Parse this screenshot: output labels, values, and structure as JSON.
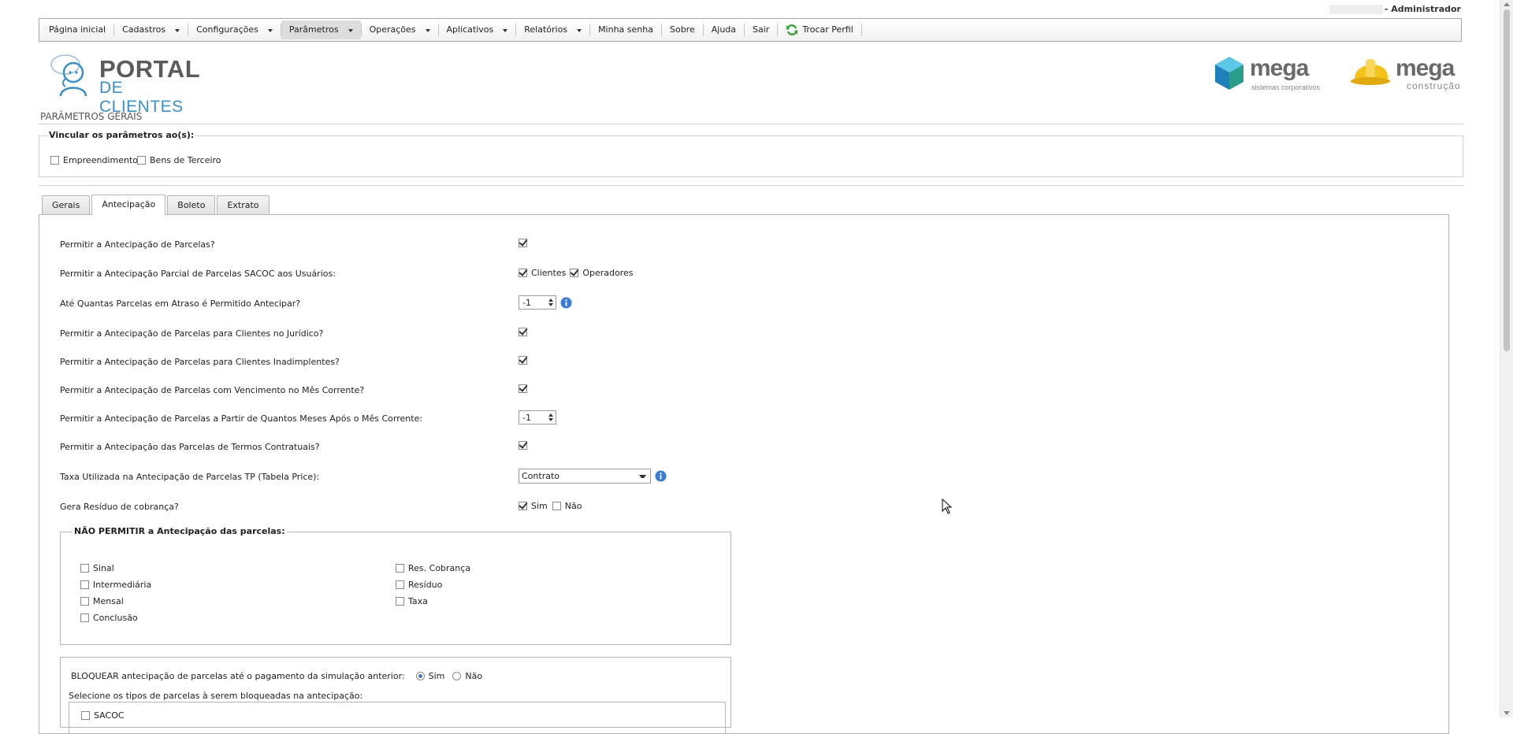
{
  "header": {
    "user_suffix": "- Administrador"
  },
  "menu": [
    {
      "label": "Página inicial",
      "has_dropdown": false
    },
    {
      "label": "Cadastros",
      "has_dropdown": true
    },
    {
      "label": "Configurações",
      "has_dropdown": true
    },
    {
      "label": "Parâmetros",
      "has_dropdown": true,
      "active": true
    },
    {
      "label": "Operações",
      "has_dropdown": true
    },
    {
      "label": "Aplicativos",
      "has_dropdown": true
    },
    {
      "label": "Relatórios",
      "has_dropdown": true
    },
    {
      "label": "Minha senha",
      "has_dropdown": false
    },
    {
      "label": "Sobre",
      "has_dropdown": false
    },
    {
      "label": "Ajuda",
      "has_dropdown": false
    },
    {
      "label": "Sair",
      "has_dropdown": false
    },
    {
      "label": "Trocar Perfil",
      "has_dropdown": false,
      "icon": "refresh-icon"
    }
  ],
  "logos": {
    "portal_title": "PORTAL",
    "portal_sub": "DE CLIENTES",
    "mega1_word": "mega",
    "mega1_tag": "sistemas corporativos",
    "mega2_word": "mega",
    "mega2_tag": "construção"
  },
  "page": {
    "title": "PARÂMETROS GERAIS",
    "vincular_legend": "Vincular os parâmetros ao(s):",
    "vincular_options": [
      {
        "label": "Empreendimento",
        "checked": false
      },
      {
        "label": "Bens de Terceiro",
        "checked": false
      }
    ]
  },
  "tabs": [
    {
      "label": "Gerais",
      "active": false
    },
    {
      "label": "Antecipação",
      "active": true
    },
    {
      "label": "Boleto",
      "active": false
    },
    {
      "label": "Extrato",
      "active": false
    }
  ],
  "form": {
    "q1": "Permitir a Antecipação de Parcelas?",
    "q2": "Permitir a Antecipação Parcial de Parcelas SACOC aos Usuários:",
    "q2_opt1": "Clientes",
    "q2_opt2": "Operadores",
    "q3": "Até Quantas Parcelas em Atraso é Permitido Antecipar?",
    "q3_value": "-1",
    "q4": "Permitir a Antecipação de Parcelas para Clientes no Jurídico?",
    "q5": "Permitir a Antecipação de Parcelas para Clientes Inadimplentes?",
    "q6": "Permitir a Antecipação de Parcelas com Vencimento no Mês Corrente?",
    "q7": "Permitir a Antecipação de Parcelas a Partir de Quantos Meses Após o Mês Corrente:",
    "q7_value": "-1",
    "q8": "Permitir a Antecipação das Parcelas de Termos Contratuais?",
    "q9": "Taxa Utilizada na Antecipação de Parcelas TP (Tabela Price):",
    "q9_value": "Contrato",
    "q10": "Gera Resíduo de cobrança?",
    "q10_yes": "Sim",
    "q10_no": "Não"
  },
  "nao_permitir": {
    "legend": "NÃO PERMITIR a Antecipação das parcelas:",
    "left": [
      "Sinal",
      "Intermediária",
      "Mensal",
      "Conclusão"
    ],
    "right": [
      "Res. Cobrança",
      "Resíduo",
      "Taxa"
    ]
  },
  "bloquear": {
    "label": "BLOQUEAR antecipação de parcelas até o pagamento da simulação anterior:",
    "yes": "Sim",
    "no": "Não",
    "selecione": "Selecione os tipos de parcelas à serem bloqueadas na antecipação:",
    "first_type": "SACOC"
  },
  "colors": {
    "accent_blue": "#3b8fc6",
    "info_blue": "#3a7bd5",
    "mega_blue": "#2a8fc0",
    "mega_yellow": "#f3c21b"
  }
}
